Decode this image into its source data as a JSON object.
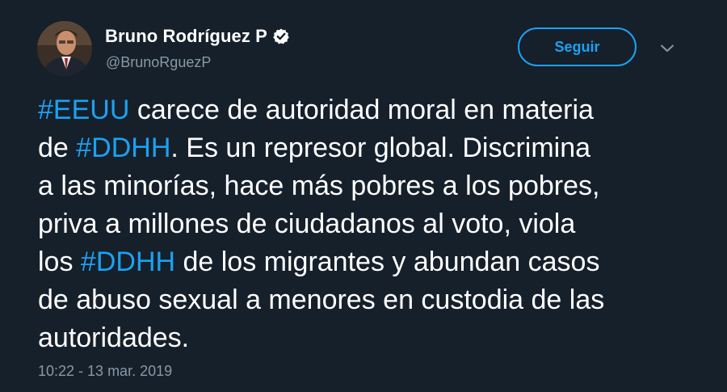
{
  "author": {
    "display_name": "Bruno Rodríguez P",
    "handle": "@BrunoRguezP",
    "verified": true
  },
  "actions": {
    "follow_label": "Seguir",
    "menu_icon": "chevron-down-icon"
  },
  "tweet": {
    "lines": [
      [
        {
          "text": "#EEUU",
          "hashtag": true
        },
        {
          "text": " carece de autoridad moral en materia",
          "hashtag": false
        }
      ],
      [
        {
          "text": "de ",
          "hashtag": false
        },
        {
          "text": "#DDHH",
          "hashtag": true
        },
        {
          "text": ". Es un represor global. Discrimina",
          "hashtag": false
        }
      ],
      [
        {
          "text": "a las minorías, hace más pobres a los pobres,",
          "hashtag": false
        }
      ],
      [
        {
          "text": "priva a millones de ciudadanos al voto, viola",
          "hashtag": false
        }
      ],
      [
        {
          "text": "los ",
          "hashtag": false
        },
        {
          "text": "#DDHH",
          "hashtag": true
        },
        {
          "text": " de los migrantes y abundan casos",
          "hashtag": false
        }
      ],
      [
        {
          "text": "de abuso sexual a menores en custodia de las",
          "hashtag": false
        }
      ],
      [
        {
          "text": "autoridades.",
          "hashtag": false
        }
      ]
    ],
    "timestamp": "10:22 - 13 mar. 2019"
  },
  "colors": {
    "background": "#15202b",
    "accent": "#1da1f2",
    "secondary_text": "#8899a6",
    "primary_text": "#ffffff"
  }
}
